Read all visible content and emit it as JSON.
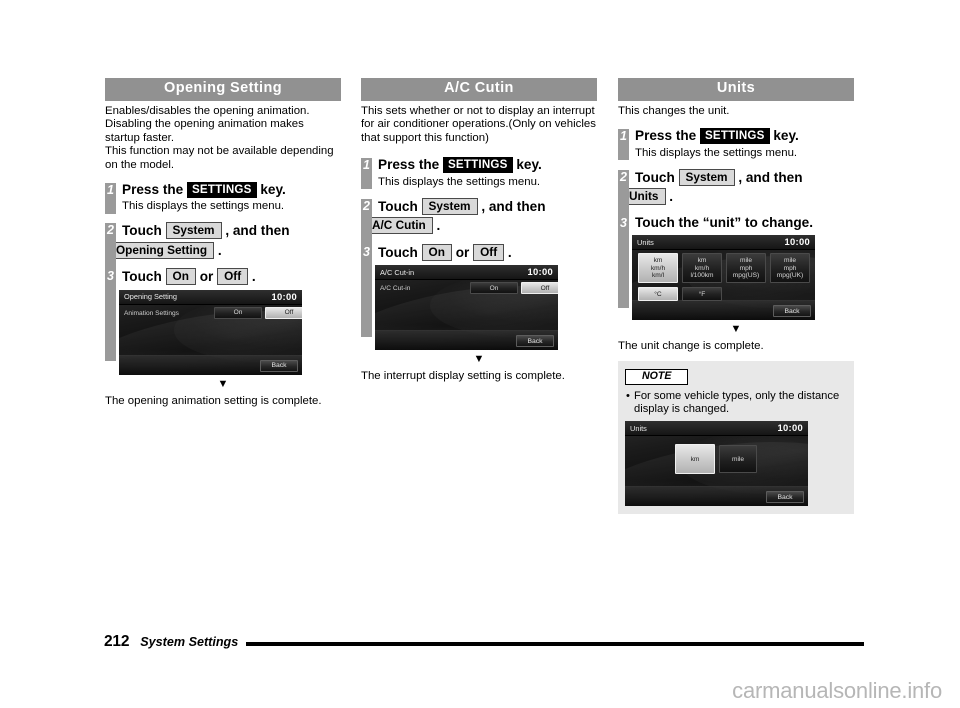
{
  "page": {
    "number": "212",
    "section": "System Settings",
    "watermark": "carmanualsonline.info"
  },
  "columns": [
    {
      "header": "Opening Setting",
      "intro": "Enables/disables the opening animation. Disabling the opening animation makes startup faster.\nThis function may not be available depending on the model.",
      "steps": [
        {
          "num": "1",
          "title_pre": "Press the",
          "chip": "SETTINGS",
          "title_post": "key.",
          "sub": "This displays the settings menu."
        },
        {
          "num": "2",
          "title_pre": "Touch",
          "chip": "System",
          "title_mid": ", and then",
          "chip2": "Opening Setting",
          "title_post": "."
        },
        {
          "num": "3",
          "title_pre": "Touch",
          "chip": "On",
          "title_mid": "or",
          "chip2": "Off",
          "title_post": "."
        }
      ],
      "screen": {
        "title": "Opening Setting",
        "clock": "10:00",
        "row_label": "Animation Settings",
        "btn_on": "On",
        "btn_off": "Off",
        "back": "Back"
      },
      "arrow": "▼",
      "result": "The opening animation setting is complete."
    },
    {
      "header": "A/C Cutin",
      "intro": "This sets whether or not to display an interrupt for air conditioner operations.(Only on vehicles that support this function)",
      "steps": [
        {
          "num": "1",
          "title_pre": "Press the",
          "chip": "SETTINGS",
          "title_post": "key.",
          "sub": "This displays the settings menu."
        },
        {
          "num": "2",
          "title_pre": "Touch",
          "chip": "System",
          "title_mid": ", and then",
          "chip2": "A/C Cutin",
          "title_post": "."
        },
        {
          "num": "3",
          "title_pre": "Touch",
          "chip": "On",
          "title_mid": "or",
          "chip2": "Off",
          "title_post": "."
        }
      ],
      "screen": {
        "title": "A/C Cut-in",
        "clock": "10:00",
        "row_label": "A/C Cut-in",
        "btn_on": "On",
        "btn_off": "Off",
        "back": "Back"
      },
      "arrow": "▼",
      "result": "The interrupt display setting is complete."
    },
    {
      "header": "Units",
      "intro": "This changes the unit.",
      "steps": [
        {
          "num": "1",
          "title_pre": "Press the",
          "chip": "SETTINGS",
          "title_post": "key.",
          "sub": "This displays the settings menu."
        },
        {
          "num": "2",
          "title_pre": "Touch",
          "chip": "System",
          "title_mid": ", and then",
          "chip2": "Units",
          "title_post": "."
        },
        {
          "num": "3",
          "title_plain": "Touch the “unit” to change."
        }
      ],
      "screen": {
        "title": "Units",
        "clock": "10:00",
        "unit_buttons": [
          {
            "lines": [
              "km",
              "km/h",
              "km/l"
            ],
            "selected": true
          },
          {
            "lines": [
              "km",
              "km/h",
              "l/100km"
            ],
            "selected": false
          },
          {
            "lines": [
              "mile",
              "mph",
              "mpg(US)"
            ],
            "selected": false
          },
          {
            "lines": [
              "mile",
              "mph",
              "mpg(UK)"
            ],
            "selected": false
          }
        ],
        "temp_buttons": [
          {
            "label": "°C",
            "selected": true
          },
          {
            "label": "°F",
            "selected": false
          }
        ],
        "back": "Back"
      },
      "arrow": "▼",
      "result": "The unit change is complete.",
      "note": {
        "tab": "NOTE",
        "bullet": "•",
        "text": "For some vehicle types, only the distance display is changed.",
        "screen": {
          "title": "Units",
          "clock": "10:00",
          "buttons": [
            {
              "label": "km",
              "selected": true
            },
            {
              "label": "mile",
              "selected": false
            }
          ],
          "back": "Back"
        }
      }
    }
  ],
  "colors": {
    "header_bg": "#919191",
    "step_bar": "#9a9a9a",
    "chip_gray": "#d9d9d9",
    "chip_black": "#000000",
    "note_bg": "#e8e8e8"
  }
}
